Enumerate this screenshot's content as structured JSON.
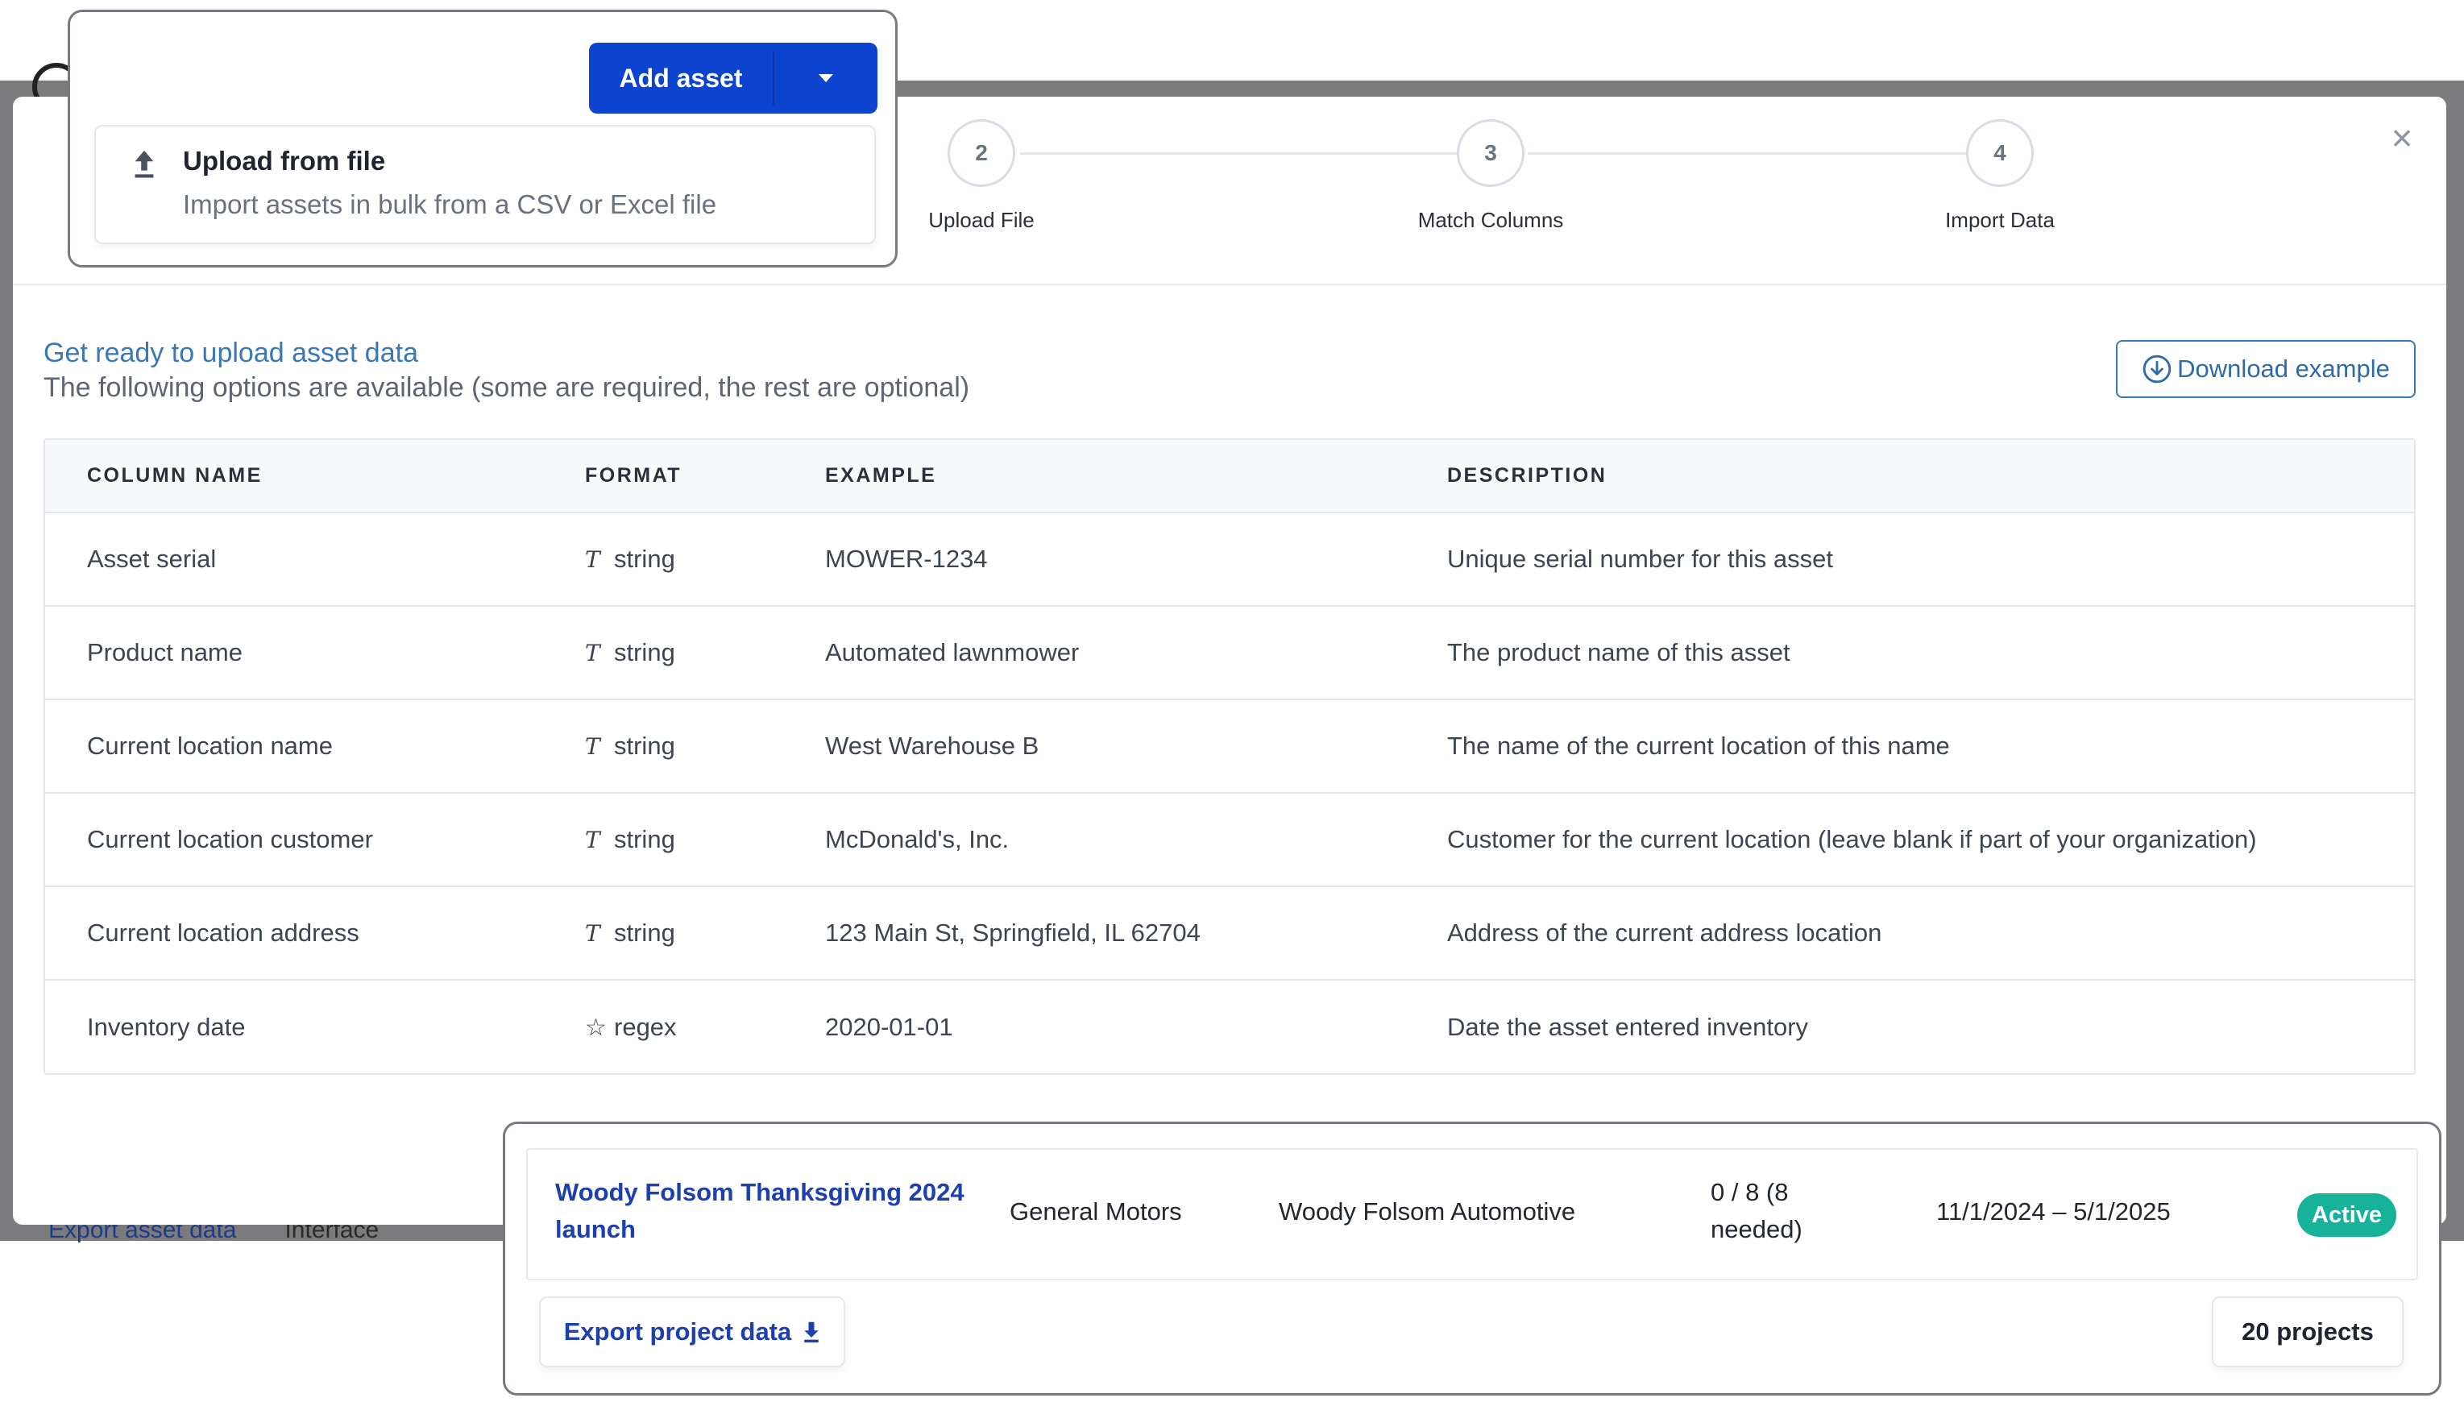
{
  "background": {
    "footer_link": "Export asset data",
    "footer_text": "Interface"
  },
  "stepper": {
    "steps": [
      {
        "number": "2",
        "label": "Upload File"
      },
      {
        "number": "3",
        "label": "Match Columns"
      },
      {
        "number": "4",
        "label": "Import Data"
      }
    ]
  },
  "intro": {
    "title": "Get ready to upload asset data",
    "subtitle": "The following options are available (some are required, the rest are optional)"
  },
  "download_button": "Download example",
  "table": {
    "headers": [
      "COLUMN NAME",
      "FORMAT",
      "EXAMPLE",
      "DESCRIPTION"
    ],
    "rows": [
      {
        "name": "Asset serial",
        "format_icon": "text-type-icon",
        "format": "string",
        "example": "MOWER-1234",
        "description": "Unique serial number for this asset"
      },
      {
        "name": "Product name",
        "format_icon": "text-type-icon",
        "format": "string",
        "example": "Automated lawnmower",
        "description": "The product name of this asset"
      },
      {
        "name": "Current location name",
        "format_icon": "text-type-icon",
        "format": "string",
        "example": "West Warehouse B",
        "description": "The name of the current location of this name"
      },
      {
        "name": "Current location customer",
        "format_icon": "text-type-icon",
        "format": "string",
        "example": "McDonald's, Inc.",
        "description": "Customer for the current location (leave blank if part of your organization)"
      },
      {
        "name": "Current location address",
        "format_icon": "text-type-icon",
        "format": "string",
        "example": "123 Main St, Springfield, IL 62704",
        "description": "Address of the current address location"
      },
      {
        "name": "Inventory date",
        "format_icon": "star-icon",
        "format": "regex",
        "example": "2020-01-01",
        "description": "Date the asset entered inventory"
      }
    ]
  },
  "add_asset": {
    "button_label": "Add asset",
    "option_title": "Upload from file",
    "option_description": "Import assets in bulk from a CSV or Excel file"
  },
  "projects": {
    "row": {
      "name": "Woody Folsom Thanksgiving 2024 launch",
      "client": "General Motors",
      "organization": "Woody Folsom Automotive",
      "count": "0 / 8 (8 needed)",
      "dates": "11/1/2024 – 5/1/2025",
      "status": "Active"
    },
    "export_label": "Export project data",
    "total": "20 projects"
  },
  "colors": {
    "primary": "#0d44cf",
    "link": "#3a78b5",
    "status_active": "#16b39a"
  }
}
